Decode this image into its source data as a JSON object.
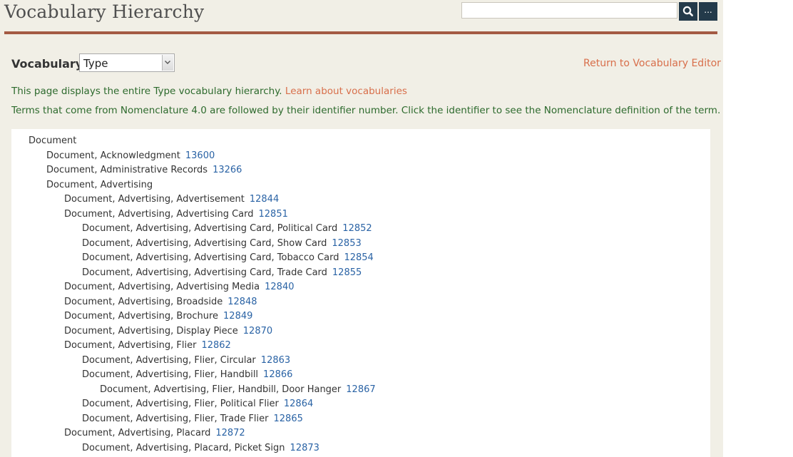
{
  "header": {
    "title": "Vocabulary Hierarchy",
    "search": {
      "value": "",
      "placeholder": ""
    },
    "search_icon": "search-icon",
    "more_label": "..."
  },
  "vocabulary": {
    "label": "Vocabulary:",
    "selected": "Type"
  },
  "return_link": "Return to Vocabulary Editor",
  "info": {
    "line1_text": "This page displays the entire Type vocabulary hierarchy.",
    "line1_link": "Learn about vocabularies",
    "line2_text": "Terms that come from Nomenclature 4.0 are followed by their identifier number. Click the identifier to see the Nomenclature definition of the term."
  },
  "colors": {
    "divider": "#a45a43",
    "link": "#d86f4b",
    "info_text": "#2d6a2d",
    "identifier": "#2a63a5",
    "button": "#233a4a"
  },
  "terms": [
    {
      "label": "Document",
      "code": "",
      "level": 0
    },
    {
      "label": "Document, Acknowledgment",
      "code": "13600",
      "level": 1
    },
    {
      "label": "Document, Administrative Records",
      "code": "13266",
      "level": 1
    },
    {
      "label": "Document, Advertising",
      "code": "",
      "level": 1
    },
    {
      "label": "Document, Advertising, Advertisement",
      "code": "12844",
      "level": 2
    },
    {
      "label": "Document, Advertising, Advertising Card",
      "code": "12851",
      "level": 2
    },
    {
      "label": "Document, Advertising, Advertising Card, Political Card",
      "code": "12852",
      "level": 3
    },
    {
      "label": "Document, Advertising, Advertising Card, Show Card",
      "code": "12853",
      "level": 3
    },
    {
      "label": "Document, Advertising, Advertising Card, Tobacco Card",
      "code": "12854",
      "level": 3
    },
    {
      "label": "Document, Advertising, Advertising Card, Trade Card",
      "code": "12855",
      "level": 3
    },
    {
      "label": "Document, Advertising, Advertising Media",
      "code": "12840",
      "level": 2
    },
    {
      "label": "Document, Advertising, Broadside",
      "code": "12848",
      "level": 2
    },
    {
      "label": "Document, Advertising, Brochure",
      "code": "12849",
      "level": 2
    },
    {
      "label": "Document, Advertising, Display Piece",
      "code": "12870",
      "level": 2
    },
    {
      "label": "Document, Advertising, Flier",
      "code": "12862",
      "level": 2
    },
    {
      "label": "Document, Advertising, Flier, Circular",
      "code": "12863",
      "level": 3
    },
    {
      "label": "Document, Advertising, Flier, Handbill",
      "code": "12866",
      "level": 3
    },
    {
      "label": "Document, Advertising, Flier, Handbill, Door Hanger",
      "code": "12867",
      "level": 4
    },
    {
      "label": "Document, Advertising, Flier, Political Flier",
      "code": "12864",
      "level": 3
    },
    {
      "label": "Document, Advertising, Flier, Trade Flier",
      "code": "12865",
      "level": 3
    },
    {
      "label": "Document, Advertising, Placard",
      "code": "12872",
      "level": 2
    },
    {
      "label": "Document, Advertising, Placard, Picket Sign",
      "code": "12873",
      "level": 3
    }
  ]
}
